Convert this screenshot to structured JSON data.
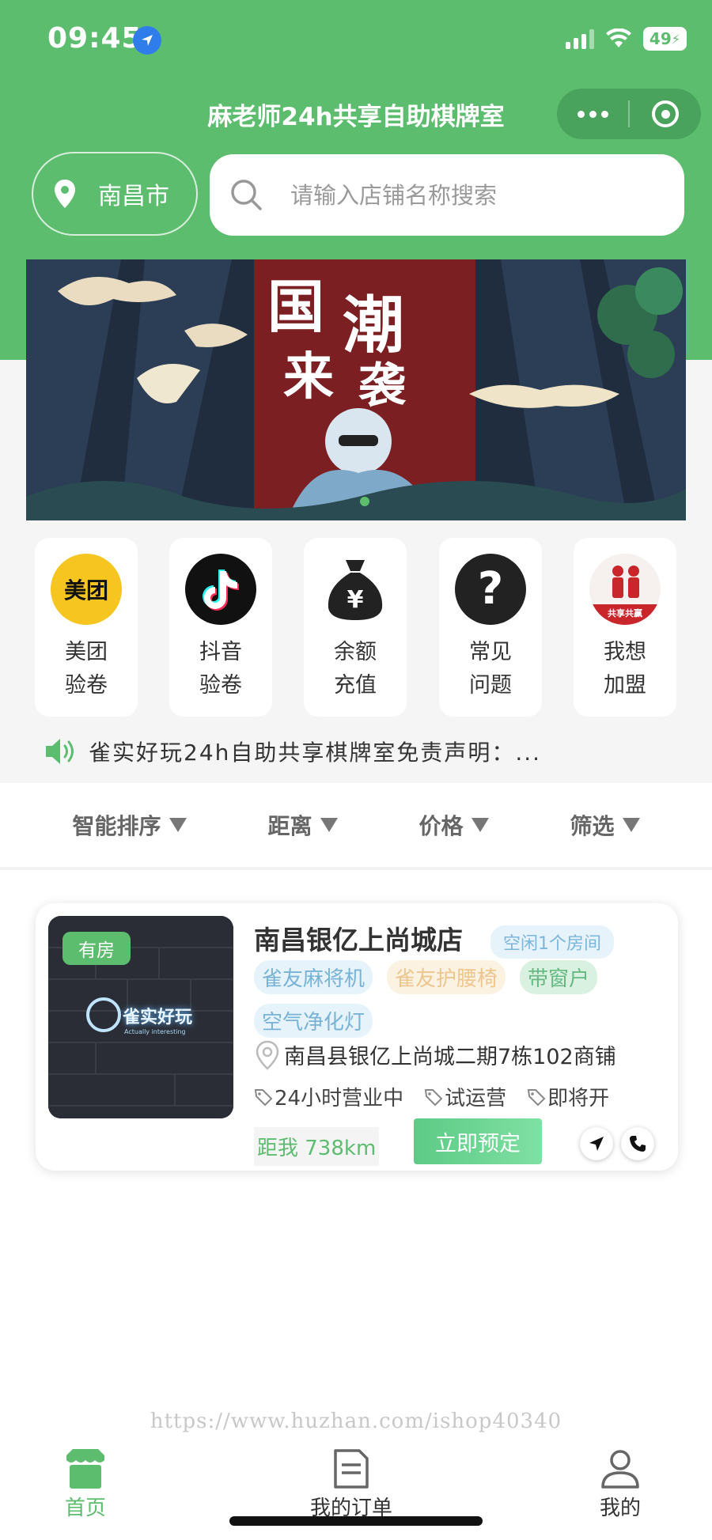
{
  "status_bar": {
    "time": "09:45",
    "battery": "49"
  },
  "header": {
    "title": "麻老师24h共享自助棋牌室"
  },
  "search": {
    "city": "南昌市",
    "placeholder": "请输入店铺名称搜索"
  },
  "banner": {
    "alt": "国潮来袭"
  },
  "quick_actions": [
    {
      "label": "美团验卷",
      "icon": "meituan-icon",
      "icon_text": "美团"
    },
    {
      "label": "抖音验卷",
      "icon": "douyin-icon"
    },
    {
      "label": "余额充值",
      "icon": "money-bag-icon"
    },
    {
      "label": "常见问题",
      "icon": "question-icon"
    },
    {
      "label": "我想加盟",
      "icon": "join-icon",
      "icon_text": "共享共赢"
    }
  ],
  "notice": {
    "text": "雀实好玩24h自助共享棋牌室免责声明：..."
  },
  "filters": [
    "智能排序",
    "距离",
    "价格",
    "筛选"
  ],
  "store": {
    "room_badge": "有房",
    "thumb_brand": "雀实好玩",
    "thumb_sub": "Actually interesting",
    "name": "南昌银亿上尚城店",
    "free_badge": "空闲1个房间",
    "tags": [
      "雀友麻将机",
      "雀友护腰椅",
      "带窗户",
      "空气净化灯"
    ],
    "address": "南昌县银亿上尚城二期7栋102商铺",
    "meta": [
      "24小时营业中",
      "试运营",
      "即将开"
    ],
    "distance": "距我 738km",
    "book_label": "立即预定"
  },
  "watermark": "https://www.huzhan.com/ishop40340",
  "tabbar": [
    {
      "label": "首页",
      "icon": "home-icon",
      "active": true
    },
    {
      "label": "我的订单",
      "icon": "order-icon",
      "active": false
    },
    {
      "label": "我的",
      "icon": "profile-icon",
      "active": false
    }
  ],
  "colors": {
    "brand_green": "#5dbd6f",
    "free_badge_bg": "#e7f3fb"
  }
}
